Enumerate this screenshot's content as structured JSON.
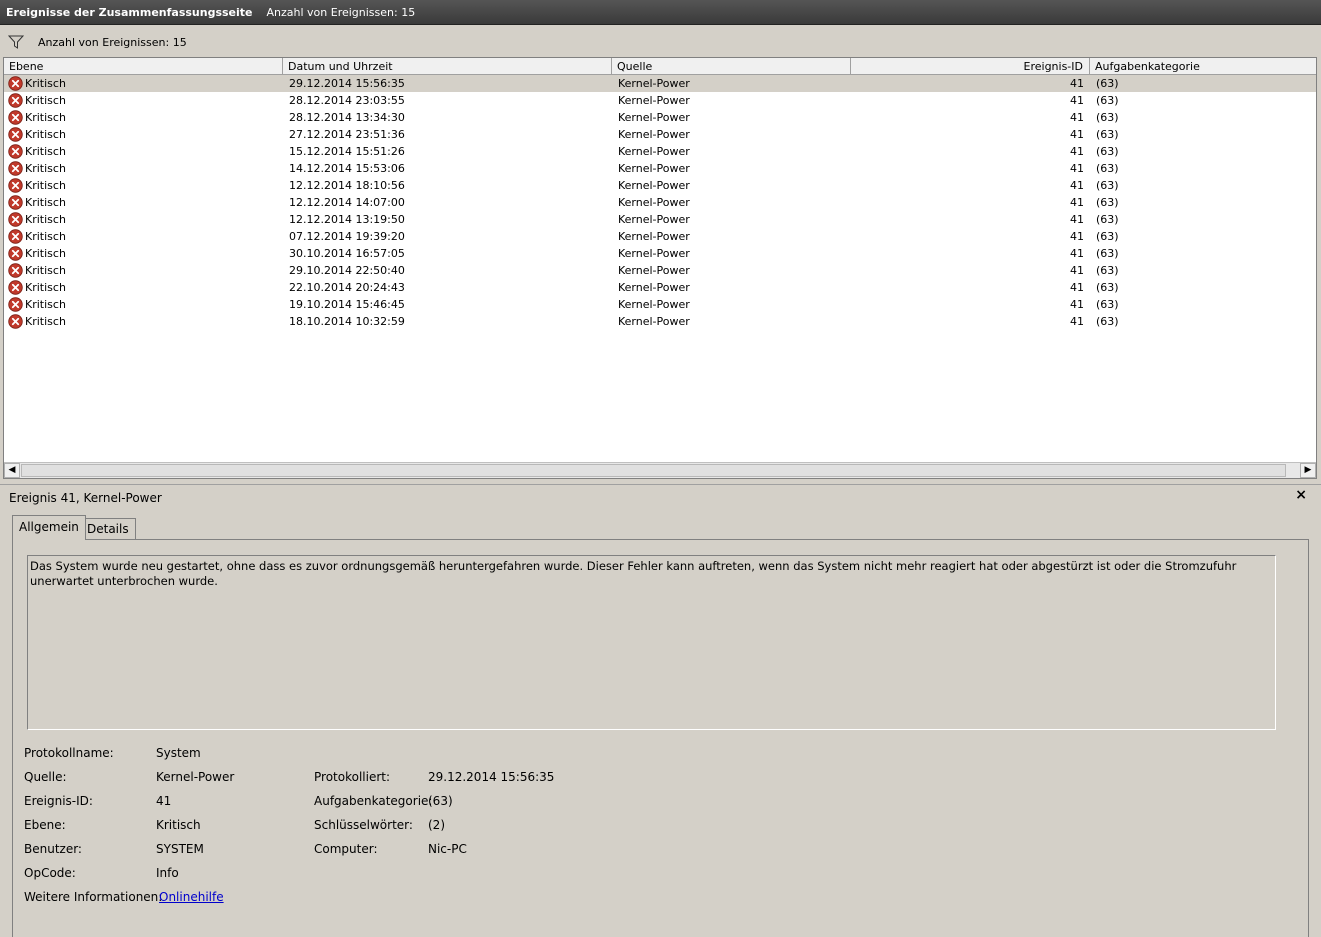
{
  "titlebar": {
    "title": "Ereignisse der Zusammenfassungsseite",
    "count": "Anzahl von Ereignissen: 15"
  },
  "filterbar": {
    "icon": "filter-icon",
    "text": "Anzahl von Ereignissen: 15"
  },
  "grid": {
    "columns": [
      "Ebene",
      "Datum und Uhrzeit",
      "Quelle",
      "Ereignis-ID",
      "Aufgabenkategorie"
    ],
    "rows": [
      {
        "level": "Kritisch",
        "datetime": "29.12.2014 15:56:35",
        "source": "Kernel-Power",
        "id": "41",
        "category": "(63)"
      },
      {
        "level": "Kritisch",
        "datetime": "28.12.2014 23:03:55",
        "source": "Kernel-Power",
        "id": "41",
        "category": "(63)"
      },
      {
        "level": "Kritisch",
        "datetime": "28.12.2014 13:34:30",
        "source": "Kernel-Power",
        "id": "41",
        "category": "(63)"
      },
      {
        "level": "Kritisch",
        "datetime": "27.12.2014 23:51:36",
        "source": "Kernel-Power",
        "id": "41",
        "category": "(63)"
      },
      {
        "level": "Kritisch",
        "datetime": "15.12.2014 15:51:26",
        "source": "Kernel-Power",
        "id": "41",
        "category": "(63)"
      },
      {
        "level": "Kritisch",
        "datetime": "14.12.2014 15:53:06",
        "source": "Kernel-Power",
        "id": "41",
        "category": "(63)"
      },
      {
        "level": "Kritisch",
        "datetime": "12.12.2014 18:10:56",
        "source": "Kernel-Power",
        "id": "41",
        "category": "(63)"
      },
      {
        "level": "Kritisch",
        "datetime": "12.12.2014 14:07:00",
        "source": "Kernel-Power",
        "id": "41",
        "category": "(63)"
      },
      {
        "level": "Kritisch",
        "datetime": "12.12.2014 13:19:50",
        "source": "Kernel-Power",
        "id": "41",
        "category": "(63)"
      },
      {
        "level": "Kritisch",
        "datetime": "07.12.2014 19:39:20",
        "source": "Kernel-Power",
        "id": "41",
        "category": "(63)"
      },
      {
        "level": "Kritisch",
        "datetime": "30.10.2014 16:57:05",
        "source": "Kernel-Power",
        "id": "41",
        "category": "(63)"
      },
      {
        "level": "Kritisch",
        "datetime": "29.10.2014 22:50:40",
        "source": "Kernel-Power",
        "id": "41",
        "category": "(63)"
      },
      {
        "level": "Kritisch",
        "datetime": "22.10.2014 20:24:43",
        "source": "Kernel-Power",
        "id": "41",
        "category": "(63)"
      },
      {
        "level": "Kritisch",
        "datetime": "19.10.2014 15:46:45",
        "source": "Kernel-Power",
        "id": "41",
        "category": "(63)"
      },
      {
        "level": "Kritisch",
        "datetime": "18.10.2014 10:32:59",
        "source": "Kernel-Power",
        "id": "41",
        "category": "(63)"
      }
    ]
  },
  "detail": {
    "title": "Ereignis 41, Kernel-Power",
    "close": "×",
    "tabs": [
      "Allgemein",
      "Details"
    ],
    "message": "Das System wurde neu gestartet, ohne dass es zuvor ordnungsgemäß heruntergefahren wurde. Dieser Fehler kann auftreten, wenn das System nicht mehr reagiert hat oder abgestürzt ist oder die Stromzufuhr unerwartet unterbrochen wurde.",
    "fields": {
      "protokollname_label": "Protokollname:",
      "protokollname": "System",
      "quelle_label": "Quelle:",
      "quelle": "Kernel-Power",
      "protokolliert_label": "Protokolliert:",
      "protokolliert": "29.12.2014 15:56:35",
      "ereignisid_label": "Ereignis-ID:",
      "ereignisid": "41",
      "aufgabenkategorie_label": "Aufgabenkategorie:",
      "aufgabenkategorie": "(63)",
      "ebene_label": "Ebene:",
      "ebene": "Kritisch",
      "schluesselwoerter_label": "Schlüsselwörter:",
      "schluesselwoerter": "(2)",
      "benutzer_label": "Benutzer:",
      "benutzer": "SYSTEM",
      "computer_label": "Computer:",
      "computer": "Nic-PC",
      "opcode_label": "OpCode:",
      "opcode": "Info",
      "weitere_label": "Weitere Informationen:",
      "weitere_link": "Onlinehilfe"
    }
  },
  "colors": {
    "selected_row": "#d4d0c8",
    "error_icon": "#c0392b",
    "link": "#0000cc"
  }
}
